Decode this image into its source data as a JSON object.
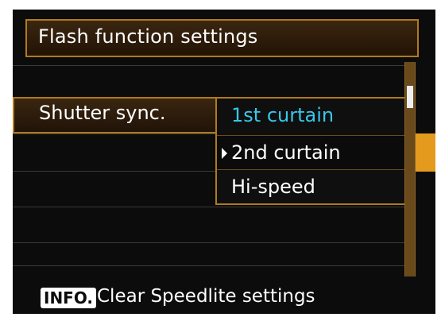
{
  "header": {
    "title": "Flash function settings"
  },
  "setting": {
    "label": "Shutter sync."
  },
  "dropdown": {
    "options": [
      {
        "label": "1st curtain"
      },
      {
        "label": "2nd curtain"
      },
      {
        "label": "Hi-speed"
      }
    ],
    "selected_index": 0,
    "highlighted_index": 1
  },
  "footer": {
    "badge": "INFO.",
    "text": "Clear Speedlite settings"
  },
  "colors": {
    "accent": "#b07a1f",
    "highlight": "#e49b1d",
    "selected_text": "#37c7ea"
  }
}
